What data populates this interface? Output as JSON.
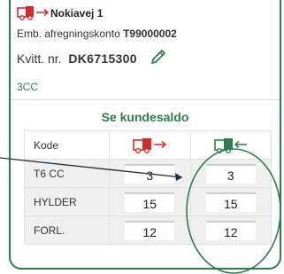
{
  "header": {
    "store_name": "Nokiavej 1",
    "account_label": "Emb. afregningskonto",
    "account_number": "T99000002",
    "receipt_label": "Kvitt. nr.",
    "receipt_number": "DK6715300",
    "extra_code": "3CC"
  },
  "saldo": {
    "title": "Se kundesaldo"
  },
  "table": {
    "code_header": "Kode",
    "rows": [
      {
        "code": "T6 CC",
        "out": "3",
        "in": "3"
      },
      {
        "code": "HYLDER",
        "out": "15",
        "in": "15"
      },
      {
        "code": "FORL.",
        "out": "12",
        "in": "12"
      }
    ]
  },
  "colors": {
    "accent_green": "#2e7d4f",
    "truck_red": "#d62a2a",
    "truck_green": "#2e7d4f"
  },
  "icons": {
    "out_truck": "red-truck-arrow-right-icon",
    "in_truck": "green-truck-arrow-left-icon",
    "edit": "pencil-icon"
  }
}
